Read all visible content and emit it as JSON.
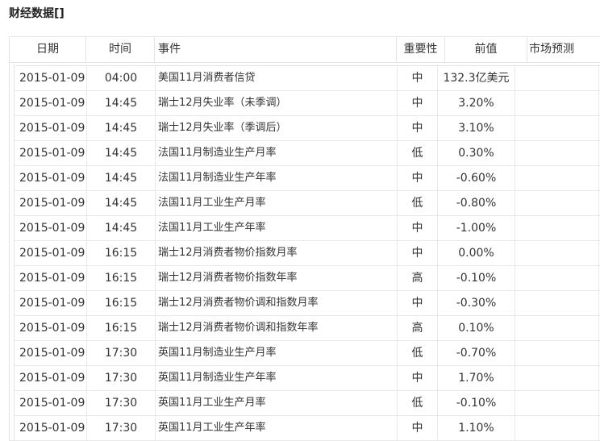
{
  "page": {
    "title": "财经数据[]"
  },
  "table": {
    "headers": {
      "date": "日期",
      "time": "时间",
      "event": "事件",
      "importance": "重要性",
      "previous": "前值",
      "forecast": "市场预测"
    },
    "rows": [
      {
        "date": "2015-01-09",
        "time": "04:00",
        "event": "美国11月消费者信贷",
        "importance": "中",
        "previous": "132.3亿美元"
      },
      {
        "date": "2015-01-09",
        "time": "14:45",
        "event": "瑞士12月失业率（未季调）",
        "importance": "中",
        "previous": "3.20%"
      },
      {
        "date": "2015-01-09",
        "time": "14:45",
        "event": "瑞士12月失业率（季调后）",
        "importance": "中",
        "previous": "3.10%"
      },
      {
        "date": "2015-01-09",
        "time": "14:45",
        "event": "法国11月制造业生产月率",
        "importance": "低",
        "previous": "0.30%"
      },
      {
        "date": "2015-01-09",
        "time": "14:45",
        "event": "法国11月制造业生产年率",
        "importance": "中",
        "previous": "-0.60%"
      },
      {
        "date": "2015-01-09",
        "time": "14:45",
        "event": "法国11月工业生产月率",
        "importance": "低",
        "previous": "-0.80%"
      },
      {
        "date": "2015-01-09",
        "time": "14:45",
        "event": "法国11月工业生产年率",
        "importance": "中",
        "previous": "-1.00%"
      },
      {
        "date": "2015-01-09",
        "time": "16:15",
        "event": "瑞士12月消费者物价指数月率",
        "importance": "中",
        "previous": "0.00%"
      },
      {
        "date": "2015-01-09",
        "time": "16:15",
        "event": "瑞士12月消费者物价指数年率",
        "importance": "高",
        "previous": "-0.10%"
      },
      {
        "date": "2015-01-09",
        "time": "16:15",
        "event": "瑞士12月消费者物价调和指数月率",
        "importance": "中",
        "previous": "-0.30%"
      },
      {
        "date": "2015-01-09",
        "time": "16:15",
        "event": "瑞士12月消费者物价调和指数年率",
        "importance": "高",
        "previous": "0.10%"
      },
      {
        "date": "2015-01-09",
        "time": "17:30",
        "event": "英国11月制造业生产月率",
        "importance": "低",
        "previous": "-0.70%"
      },
      {
        "date": "2015-01-09",
        "time": "17:30",
        "event": "英国11月制造业生产年率",
        "importance": "中",
        "previous": "1.70%"
      },
      {
        "date": "2015-01-09",
        "time": "17:30",
        "event": "英国11月工业生产月率",
        "importance": "低",
        "previous": "-0.10%"
      },
      {
        "date": "2015-01-09",
        "time": "17:30",
        "event": "英国11月工业生产年率",
        "importance": "中",
        "previous": "1.10%"
      }
    ]
  }
}
